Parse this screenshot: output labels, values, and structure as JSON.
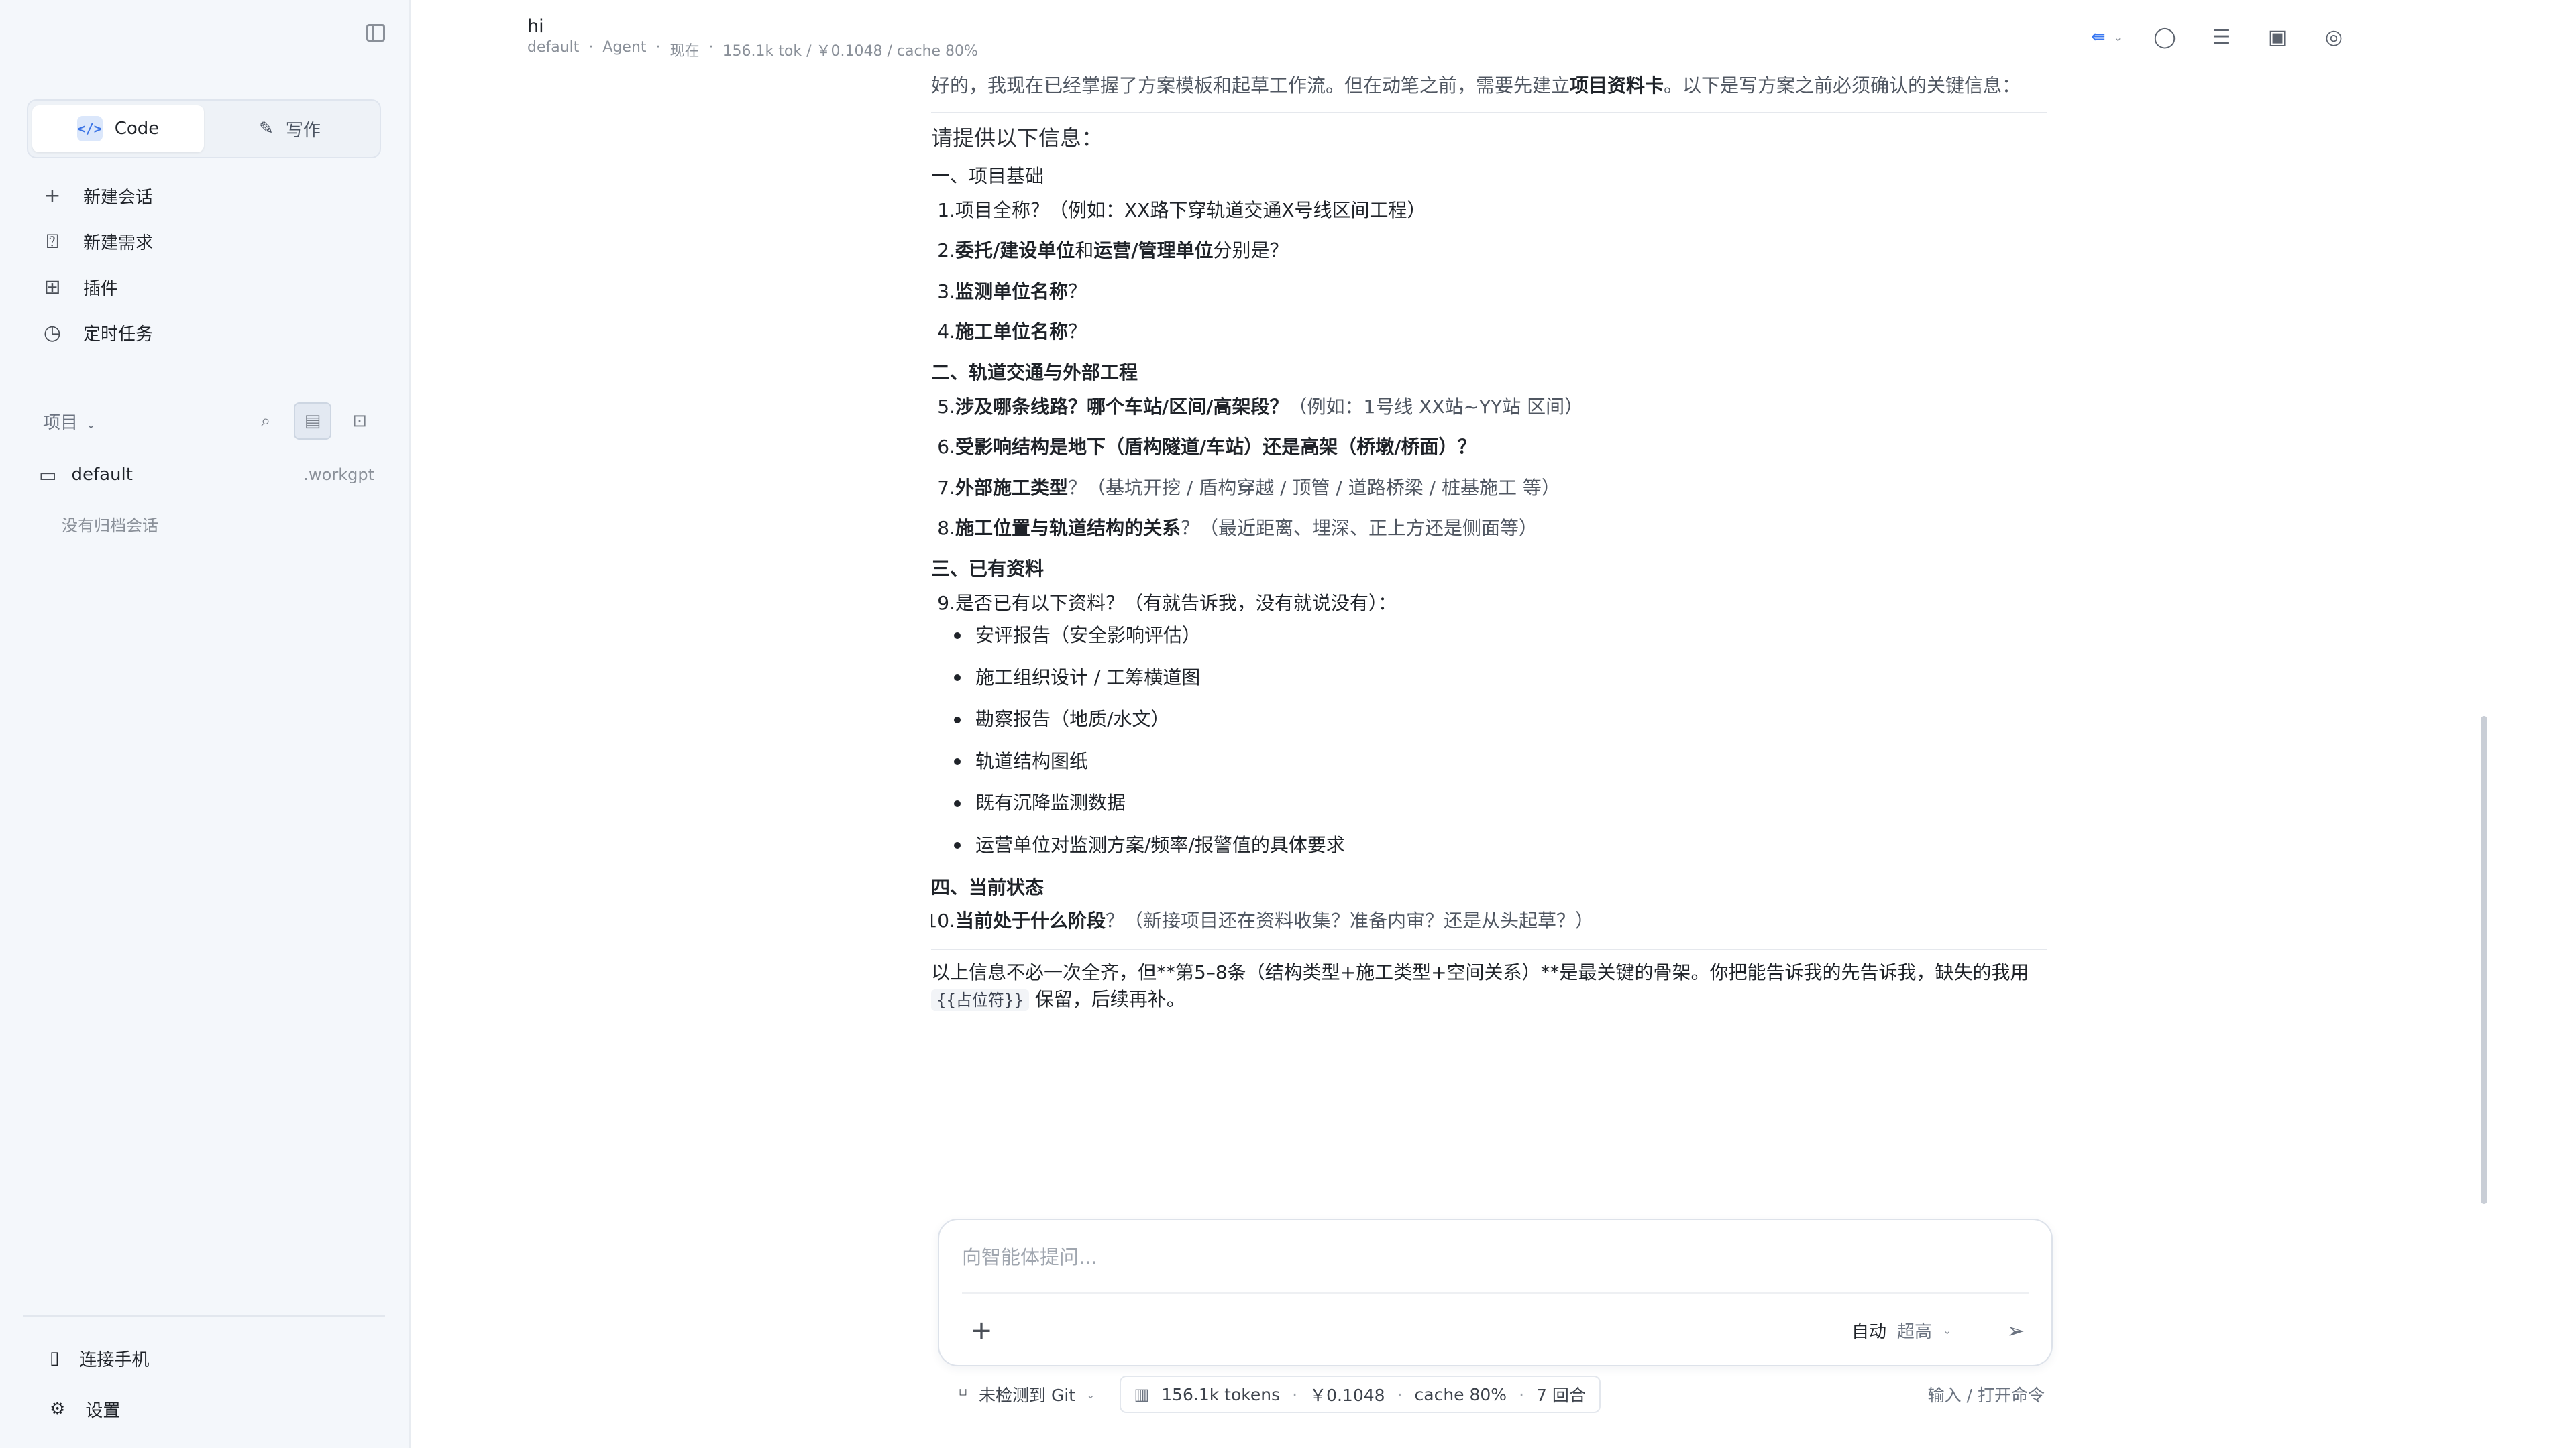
{
  "sidebar": {
    "mode_tabs": [
      {
        "label": "Code",
        "active": true
      },
      {
        "label": "写作",
        "active": false
      }
    ],
    "nav": [
      {
        "label": "新建会话",
        "icon": "plus-icon"
      },
      {
        "label": "新建需求",
        "icon": "requirement-doc-icon"
      },
      {
        "label": "插件",
        "icon": "grid-icon"
      },
      {
        "label": "定时任务",
        "icon": "clock-icon"
      }
    ],
    "projects_label": "项目",
    "project": {
      "name": "default",
      "suffix": ".workgpt"
    },
    "no_archive": "没有归档会话",
    "footer": [
      {
        "label": "连接手机",
        "icon": "phone-icon"
      },
      {
        "label": "设置",
        "icon": "gear-icon"
      }
    ]
  },
  "header": {
    "title": "hi",
    "meta": [
      "default",
      "·",
      "Agent",
      "·",
      "现在",
      "·",
      "156.1k tok / ￥0.1048 / cache 80%"
    ]
  },
  "message": {
    "intro_1": "好的，我现在已经掌握了方案模板和起草工作流。但在动笔之前，需要先建立",
    "intro_bold": "项目资料卡",
    "intro_2": "。以下是写方案之前必须确认的关键信息：",
    "request_heading": "请提供以下信息：",
    "sec1": "一、项目基础",
    "q1_num": "1.",
    "q1_text": "项目全称？（例如：XX路下穿轨道交通X号线区间工程）",
    "q2_num": "2.",
    "q2_a": "委托/建设单位",
    "q2_b": "和",
    "q2_c": "运营/管理单位",
    "q2_d": "分别是？",
    "q3_num": "3.",
    "q3_a": "监测单位名称",
    "q3_b": "？",
    "q4_num": "4.",
    "q4_a": "施工单位名称",
    "q4_b": "？",
    "sec2": "二、轨道交通与外部工程",
    "q5_num": "5.",
    "q5_a": "涉及哪条线路？哪个车站/区间/高架段？",
    "q5_b": "（例如：1号线 XX站~YY站 区间）",
    "q6_num": "6.",
    "q6_a": "受影响结构是地下（盾构隧道/车站）还是高架（桥墩/桥面）？",
    "q7_num": "7.",
    "q7_a": "外部施工类型",
    "q7_b": "？（基坑开挖 / 盾构穿越 / 顶管 / 道路桥梁 / 桩基施工 等）",
    "q8_num": "8.",
    "q8_a": "施工位置与轨道结构的关系",
    "q8_b": "？（最近距离、埋深、正上方还是侧面等）",
    "sec3": "三、已有资料",
    "q9_num": "9.",
    "q9_text": "是否已有以下资料？（有就告诉我，没有就说没有）：",
    "materials": [
      "安评报告（安全影响评估）",
      "施工组织设计 / 工筹横道图",
      "勘察报告（地质/水文）",
      "轨道结构图纸",
      "既有沉降监测数据",
      "运营单位对监测方案/频率/报警值的具体要求"
    ],
    "sec4": "四、当前状态",
    "q10_num": "10.",
    "q10_a": "当前处于什么阶段",
    "q10_b": "？（新接项目还在资料收集？准备内审？还是从头起草？）",
    "closing_1": "以上信息不必一次全齐，但**第5–8条（结构类型+施工类型+空间关系）**是最关键的骨架。你把能告诉我的先告诉我，缺失的我用 ",
    "closing_code": "{{占位符}}",
    "closing_2": " 保留，后续再补。"
  },
  "composer": {
    "placeholder": "向智能体提问...",
    "mode": "自动",
    "level": "超高"
  },
  "statusbar": {
    "git": "未检测到 Git",
    "tokens": "156.1k tokens",
    "cost": "￥0.1048",
    "cache": "cache 80%",
    "rounds": "7 回合",
    "sep": "·",
    "command_hint": "输入 / 打开命令"
  }
}
